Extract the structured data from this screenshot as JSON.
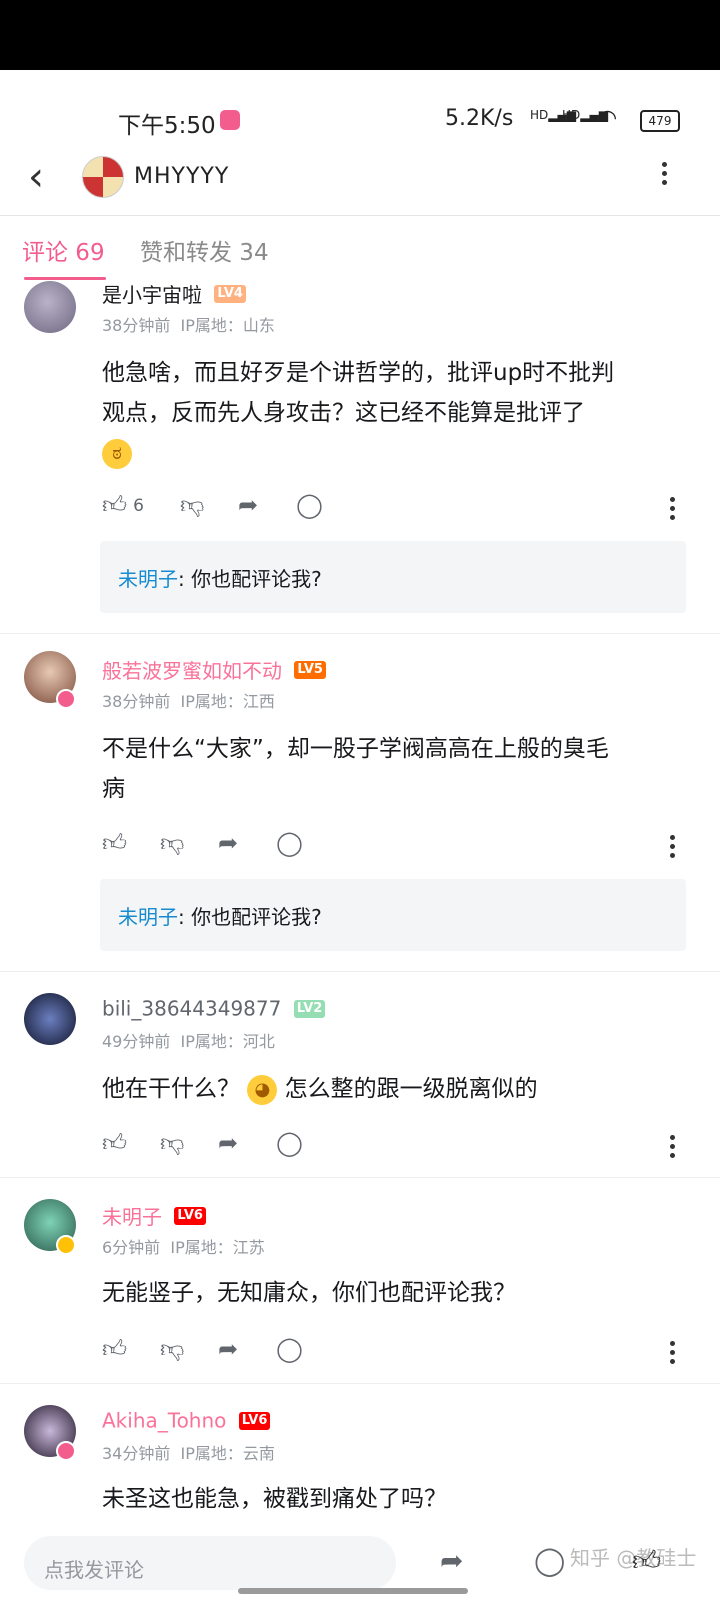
{
  "status_bar": {
    "time": "下午5:50",
    "net_speed": "5.2K/s",
    "battery": "479"
  },
  "header": {
    "username": "MHYYYY"
  },
  "tabs": [
    {
      "label": "评论 69",
      "active": true
    },
    {
      "label": "赞和转发 34",
      "active": false
    }
  ],
  "colors": {
    "accent": "#f25d8e",
    "reply_user": "#178bcf",
    "lv4": "#ffb27f",
    "lv5": "#ff6c00",
    "lv2": "#95ddb2",
    "lv6": "#ff0000"
  },
  "comments": [
    {
      "user": "是小宇宙啦",
      "level": "LV4",
      "time": "38分钟前",
      "ip": "IP属地：山东",
      "text_line1": "他急啥，而且好歹是个讲哲学的，批评up时不批判",
      "text_line2": "观点，反而先人身攻击？这已经不能算是批评了",
      "likes": "6",
      "reply": {
        "user": "未明子",
        "text": ": 你也配评论我?"
      }
    },
    {
      "user": "般若波罗蜜如如不动",
      "level": "LV5",
      "time": "38分钟前",
      "ip": "IP属地：江西",
      "text_line1": "不是什么“大家”，却一股子学阀高高在上般的臭毛",
      "text_line2": "病",
      "reply": {
        "user": "未明子",
        "text": ": 你也配评论我?"
      }
    },
    {
      "user": "bili_38644349877",
      "level": "LV2",
      "time": "49分钟前",
      "ip": "IP属地：河北",
      "text_a": "他在干什么？",
      "text_b": "怎么整的跟一级脱离似的"
    },
    {
      "user": "未明子",
      "level": "LV6",
      "time": "6分钟前",
      "ip": "IP属地：江苏",
      "text_line1": "无能竖子，无知庸众，你们也配评论我？"
    },
    {
      "user": "Akiha_Tohno",
      "level": "LV6",
      "time": "34分钟前",
      "ip": "IP属地：云南",
      "text_line1": "未圣这也能急，被戳到痛处了吗？"
    }
  ],
  "bottom_bar": {
    "placeholder": "点我发评论",
    "watermark": "知乎 @教硅士"
  }
}
